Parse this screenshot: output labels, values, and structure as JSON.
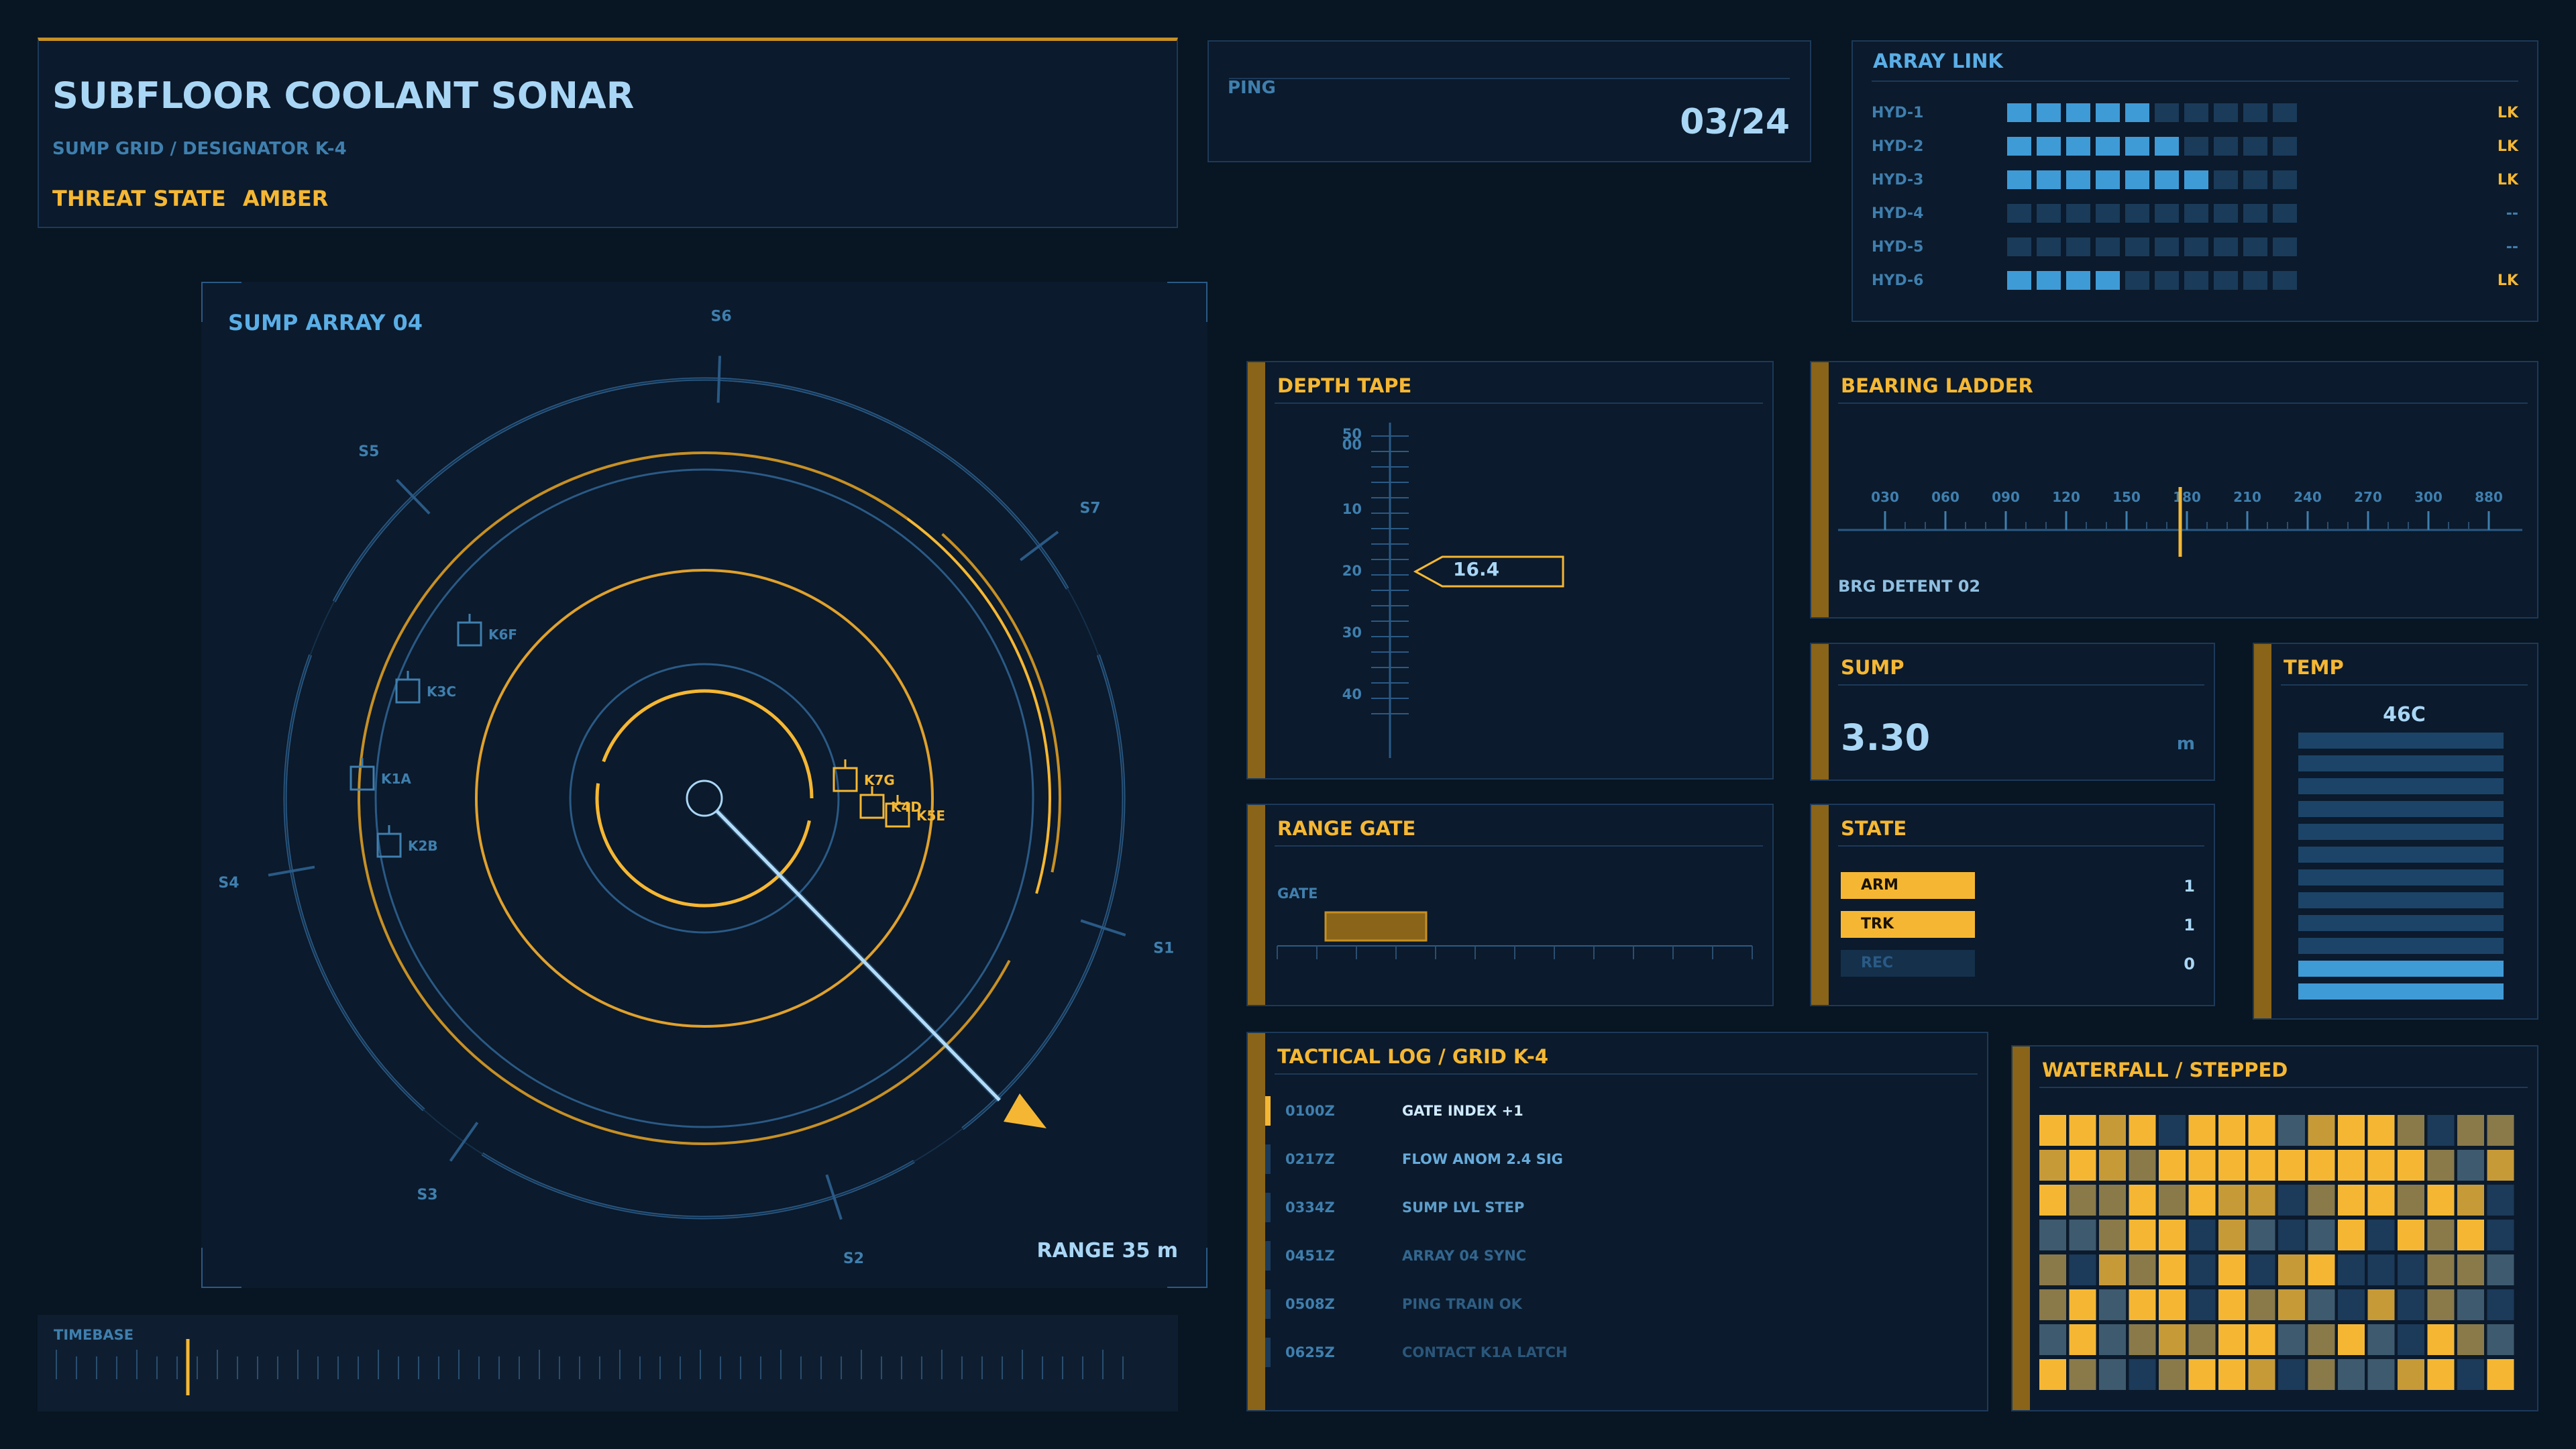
{
  "header": {
    "title": "SUBFLOOR COOLANT SONAR",
    "subtitle": "SUMP GRID / DESIGNATOR K-4",
    "threat_label": "THREAT STATE",
    "threat_value": "AMBER"
  },
  "ping": {
    "label": "PING",
    "value": "03/24"
  },
  "array_link": {
    "title": "ARRAY LINK",
    "rows": [
      {
        "name": "HYD-1",
        "level": 5,
        "status": "LK"
      },
      {
        "name": "HYD-2",
        "level": 6,
        "status": "LK"
      },
      {
        "name": "HYD-3",
        "level": 7,
        "status": "LK"
      },
      {
        "name": "HYD-4",
        "level": 0,
        "status": "--"
      },
      {
        "name": "HYD-5",
        "level": 0,
        "status": "--"
      },
      {
        "name": "HYD-6",
        "level": 4,
        "status": "LK"
      }
    ]
  },
  "sonar": {
    "title": "SUMP ARRAY 04",
    "range": "RANGE 35 m",
    "sectors": [
      "S1",
      "S2",
      "S3",
      "S4",
      "S5",
      "S6",
      "S7"
    ],
    "contacts": [
      {
        "id": "K1A",
        "hot": false
      },
      {
        "id": "K2B",
        "hot": false
      },
      {
        "id": "K3C",
        "hot": false
      },
      {
        "id": "K6F",
        "hot": false
      },
      {
        "id": "K7G",
        "hot": true
      },
      {
        "id": "K4D",
        "hot": true
      },
      {
        "id": "K5E",
        "hot": true
      }
    ]
  },
  "timebase": {
    "label": "TIMEBASE"
  },
  "depth_tape": {
    "title": "DEPTH TAPE",
    "ticks": [
      "50",
      "00",
      "10",
      "20",
      "30",
      "40"
    ],
    "value": "16.4"
  },
  "bearing": {
    "title": "BEARING LADDER",
    "ticks": [
      "030",
      "060",
      "090",
      "120",
      "150",
      "180",
      "210",
      "240",
      "270",
      "300",
      "880"
    ],
    "detent": "BRG DETENT 02",
    "cursor_index": 5
  },
  "sump": {
    "title": "SUMP",
    "value": "3.30",
    "unit": "m"
  },
  "temp": {
    "title": "TEMP",
    "value": "46C",
    "bars_total": 12,
    "bars_lit": 2
  },
  "range_gate": {
    "title": "RANGE GATE",
    "label": "GATE"
  },
  "state": {
    "title": "STATE",
    "rows": [
      {
        "name": "ARM",
        "value": "1",
        "active": true
      },
      {
        "name": "TRK",
        "value": "1",
        "active": true
      },
      {
        "name": "REC",
        "value": "0",
        "active": false
      }
    ]
  },
  "log": {
    "title": "TACTICAL LOG  /  GRID K-4",
    "entries": [
      {
        "time": "0100Z",
        "text": "GATE INDEX +1"
      },
      {
        "time": "0217Z",
        "text": "FLOW ANOM 2.4 SIG"
      },
      {
        "time": "0334Z",
        "text": "SUMP LVL STEP"
      },
      {
        "time": "0451Z",
        "text": "ARRAY 04 SYNC"
      },
      {
        "time": "0508Z",
        "text": "PING TRAIN OK"
      },
      {
        "time": "0625Z",
        "text": "CONTACT K1A LATCH"
      }
    ]
  },
  "waterfall": {
    "title": "WATERFALL  /  STEPPED"
  },
  "colors": {
    "amber": "#f5b733",
    "dim_amber": "#8a6418",
    "blue": "#3f9bd6",
    "dim_blue": "#1a3b5a",
    "bg": "#081522"
  }
}
